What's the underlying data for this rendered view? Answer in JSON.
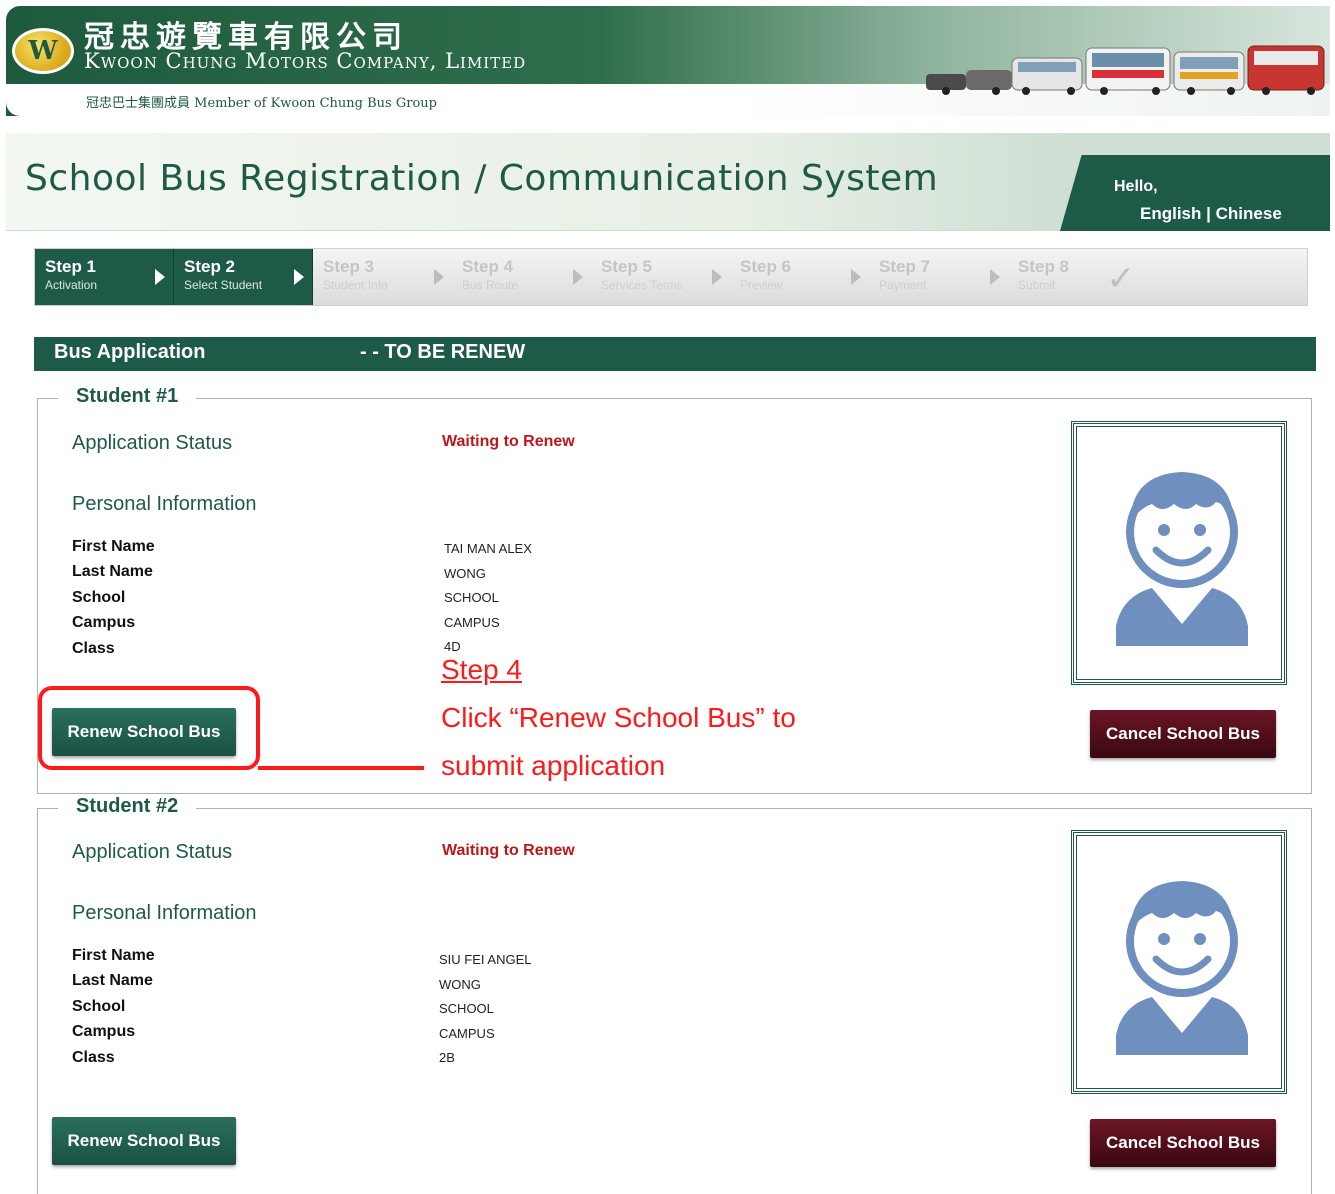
{
  "header": {
    "company_chinese": "冠忠遊覽車有限公司",
    "company_english": "Kwoon Chung Motors Company, Limited",
    "member_line": "冠忠巴士集團成員 Member of Kwoon Chung Bus Group",
    "logo_letter": "W"
  },
  "title": {
    "text": "School Bus Registration / Communication System",
    "greeting": "Hello,",
    "lang_english": "English",
    "lang_separator": "|",
    "lang_chinese": "Chinese"
  },
  "steps": [
    {
      "title": "Step 1",
      "sub": "Activation",
      "active": true
    },
    {
      "title": "Step 2",
      "sub": "Select Student",
      "active": true
    },
    {
      "title": "Step 3",
      "sub": "Student Info",
      "active": false
    },
    {
      "title": "Step 4",
      "sub": "Bus Route",
      "active": false
    },
    {
      "title": "Step 5",
      "sub": "Services Terms",
      "active": false
    },
    {
      "title": "Step 6",
      "sub": "Preview",
      "active": false
    },
    {
      "title": "Step 7",
      "sub": "Payment",
      "active": false
    },
    {
      "title": "Step 8",
      "sub": "Submit",
      "active": false
    }
  ],
  "section": {
    "title": "Bus Application",
    "status": "- - TO BE RENEW"
  },
  "labels": {
    "application_status": "Application Status",
    "personal_information": "Personal Information",
    "first_name": "First Name",
    "last_name": "Last Name",
    "school": "School",
    "campus": "Campus",
    "class": "Class",
    "renew_button": "Renew School Bus",
    "cancel_button": "Cancel School Bus"
  },
  "students": [
    {
      "legend": "Student #1",
      "status": "Waiting to Renew",
      "first_name": "TAI MAN ALEX",
      "last_name": "WONG",
      "school": "SCHOOL",
      "campus": "CAMPUS",
      "class": "4D"
    },
    {
      "legend": "Student #2",
      "status": "Waiting to Renew",
      "first_name": "SIU FEI ANGEL",
      "last_name": "WONG",
      "school": "SCHOOL",
      "campus": "CAMPUS",
      "class": "2B"
    }
  ],
  "annotation": {
    "step": "Step 4",
    "line1": "Click “Renew School Bus” to",
    "line2": "submit application",
    "color": "#ff1a1a"
  },
  "colors": {
    "brand_green": "#1e5a48",
    "status_red": "#c0161a",
    "cancel_maroon": "#5a1020"
  }
}
